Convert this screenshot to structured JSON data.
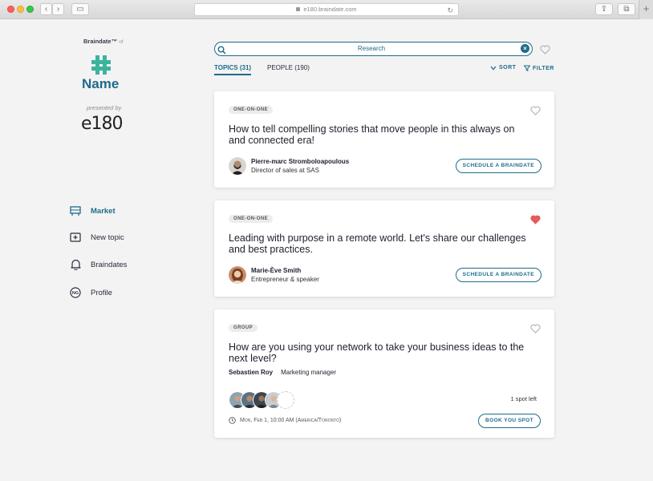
{
  "browser": {
    "url": "e180.braindate.com"
  },
  "sidebar": {
    "brand": "Braindate™",
    "brand_of": "of",
    "event_name": "Name",
    "presented_by": "presented by",
    "logo_text": "e180",
    "nav": [
      {
        "label": "Market",
        "icon": "market-icon",
        "active": true
      },
      {
        "label": "New topic",
        "icon": "new-topic-icon",
        "active": false
      },
      {
        "label": "Braindates",
        "icon": "bell-icon",
        "active": false
      },
      {
        "label": "Profile",
        "icon": "profile-avatar-icon",
        "active": false
      }
    ],
    "profile_initials": "NG"
  },
  "search": {
    "value": "Research"
  },
  "tabs": {
    "topics": "TOPICS (31)",
    "people": "PEOPLE (190)"
  },
  "actions": {
    "sort": "SORT",
    "filter": "FILTER"
  },
  "colors": {
    "accent": "#1e6b8a",
    "heart_active": "#e85a5a"
  },
  "cards": [
    {
      "type": "ONE-ON-ONE",
      "title": "How to tell compelling stories that move people in this always on and connected era!",
      "author_name": "Pierre-marc Stromboloapoulous",
      "author_role": "Director of sales at SAS",
      "cta": "SCHEDULE A BRAINDATE",
      "favorited": false
    },
    {
      "type": "ONE-ON-ONE",
      "title": "Leading with purpose in a remote world. Let's share our challenges and best practices.",
      "author_name": "Marie-Ève Smith",
      "author_role": "Entrepreneur & speaker",
      "cta": "SCHEDULE A BRAINDATE",
      "favorited": true
    },
    {
      "type": "GROUP",
      "title": "How are you using your network to take your business ideas to the next level?",
      "host_name": "Sebastien Roy",
      "host_role": "Marketing manager",
      "spots": "1 spot left",
      "datetime": "Mon, Feb 1, 10:00 AM (America/Toronto)",
      "cta": "BOOK YOU SPOT",
      "favorited": false
    }
  ]
}
